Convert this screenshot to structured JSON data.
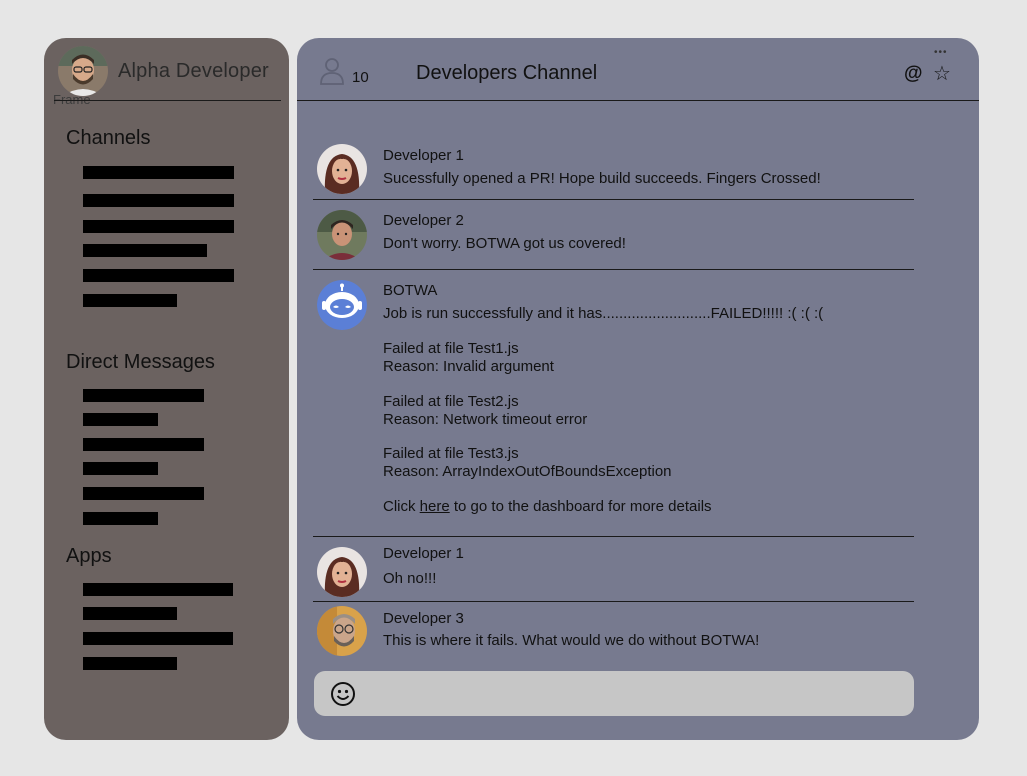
{
  "sidebar": {
    "user_name": "Alpha Developer",
    "frame_label": "Frame",
    "sections": {
      "channels": "Channels",
      "direct_messages": "Direct Messages",
      "apps": "Apps"
    }
  },
  "header": {
    "member_count": "10",
    "channel_title": "Developers Channel",
    "icons": [
      "user-icon",
      "at-icon",
      "star-icon",
      "more-icon"
    ]
  },
  "messages": [
    {
      "author": "Developer 1",
      "text": "Sucessfully opened a PR! Hope build succeeds. Fingers Crossed!"
    },
    {
      "author": "Developer 2",
      "text": "Don't worry. BOTWA got us covered!"
    },
    {
      "author": "BOTWA",
      "text": "Job is run successfully and it has..........................FAILED!!!!! :( :( :(",
      "failures": [
        {
          "file": "Failed at file Test1.js",
          "reason": "Reason: Invalid argument"
        },
        {
          "file": "Failed at file Test2.js",
          "reason": "Reason: Network timeout error"
        },
        {
          "file": "Failed at file Test3.js",
          "reason": "Reason: ArrayIndexOutOfBoundsException"
        }
      ],
      "click_prefix": "Click ",
      "link_text": "here",
      "click_suffix": " to go to the dashboard for more details"
    },
    {
      "author": "Developer 1",
      "text": "Oh no!!!"
    },
    {
      "author": "Developer 3",
      "text": "This is where it fails. What would we do without BOTWA!"
    }
  ],
  "composer": {
    "icon": "emoji-icon"
  },
  "colors": {
    "background": "#e6e6e6",
    "sidebar": "#6b6260",
    "main": "#777a8f",
    "composer": "#c6c6c6",
    "bot_avatar": "#5b7fd6"
  }
}
